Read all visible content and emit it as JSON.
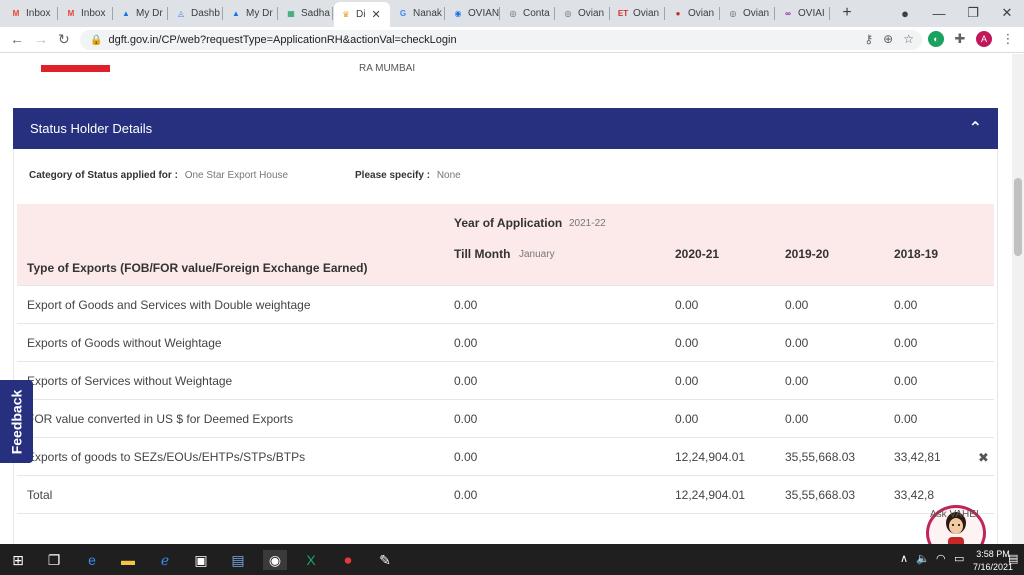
{
  "browser": {
    "tabs": [
      {
        "label": "Inbox",
        "icon": "gmail-icon",
        "color": "#ea4335",
        "glyph": "M"
      },
      {
        "label": "Inbox",
        "icon": "gmail-icon",
        "color": "#ea4335",
        "glyph": "M"
      },
      {
        "label": "My Dr",
        "icon": "drive-icon",
        "color": "#1a73e8",
        "glyph": "▲"
      },
      {
        "label": "Dashb",
        "icon": "dashboard-icon",
        "color": "#4285f4",
        "glyph": "◬"
      },
      {
        "label": "My Dr",
        "icon": "drive-icon",
        "color": "#1a73e8",
        "glyph": "▲"
      },
      {
        "label": "Sadha",
        "icon": "sheets-icon",
        "color": "#0f9d58",
        "glyph": "▦"
      },
      {
        "label": "Di",
        "icon": "dgft-icon",
        "color": "#e39b1b",
        "glyph": "♛"
      },
      {
        "label": "Nanak",
        "icon": "google-icon",
        "color": "#4285f4",
        "glyph": "G"
      },
      {
        "label": "OVIAN",
        "icon": "ovian-icon",
        "color": "#1a73e8",
        "glyph": "◉"
      },
      {
        "label": "Conta",
        "icon": "globe-icon",
        "color": "#5f6368",
        "glyph": "◎"
      },
      {
        "label": "Ovian",
        "icon": "globe-icon",
        "color": "#5f6368",
        "glyph": "◎"
      },
      {
        "label": "Ovian",
        "icon": "et-icon",
        "color": "#d32f2f",
        "glyph": "ET"
      },
      {
        "label": "Ovian",
        "icon": "ovian-red-icon",
        "color": "#c62828",
        "glyph": "●"
      },
      {
        "label": "Ovian",
        "icon": "globe-icon",
        "color": "#5f6368",
        "glyph": "◎"
      },
      {
        "label": "OVIAI",
        "icon": "ovian-loop-icon",
        "color": "#8e24aa",
        "glyph": "∞"
      }
    ],
    "url": "dgft.gov.in/CP/web?requestType=ApplicationRH&actionVal=checkLogin",
    "profile_initial": "A"
  },
  "page": {
    "region": "RA MUMBAI",
    "panel_title": "Status Holder Details",
    "category_label": "Category of Status applied for :",
    "category_value": "One Star Export House",
    "specify_label": "Please specify :",
    "specify_value": "None",
    "table": {
      "type_header": "Type of Exports (FOB/FOR value/Foreign Exchange Earned)",
      "year_label": "Year of Application",
      "year_value": "2021-22",
      "till_label": "Till Month",
      "till_value": "January",
      "col_2020": "2020-21",
      "col_2019": "2019-20",
      "col_2018": "2018-19",
      "rows": [
        {
          "type": "Export of Goods and Services with Double weightage",
          "cur": "0.00",
          "y2020": "0.00",
          "y2019": "0.00",
          "y2018": "0.00"
        },
        {
          "type": "Exports of Goods without Weightage",
          "cur": "0.00",
          "y2020": "0.00",
          "y2019": "0.00",
          "y2018": "0.00"
        },
        {
          "type": "Exports of Services without Weightage",
          "cur": "0.00",
          "y2020": "0.00",
          "y2019": "0.00",
          "y2018": "0.00"
        },
        {
          "type": "FOR value converted in US $ for Deemed Exports",
          "cur": "0.00",
          "y2020": "0.00",
          "y2019": "0.00",
          "y2018": "0.00"
        },
        {
          "type": "Exports of goods to SEZs/EOUs/EHTPs/STPs/BTPs",
          "cur": "0.00",
          "y2020": "12,24,904.01",
          "y2019": "35,55,668.03",
          "y2018": "33,42,81"
        },
        {
          "type": "Total",
          "cur": "0.00",
          "y2020": "12,24,904.01",
          "y2019": "35,55,668.03",
          "y2018": "33,42,8"
        }
      ]
    },
    "feedback_label": "Feedback",
    "assistant_label": "Ask VAHEI"
  },
  "taskbar": {
    "time": "3:58 PM",
    "date": "7/16/2021"
  }
}
